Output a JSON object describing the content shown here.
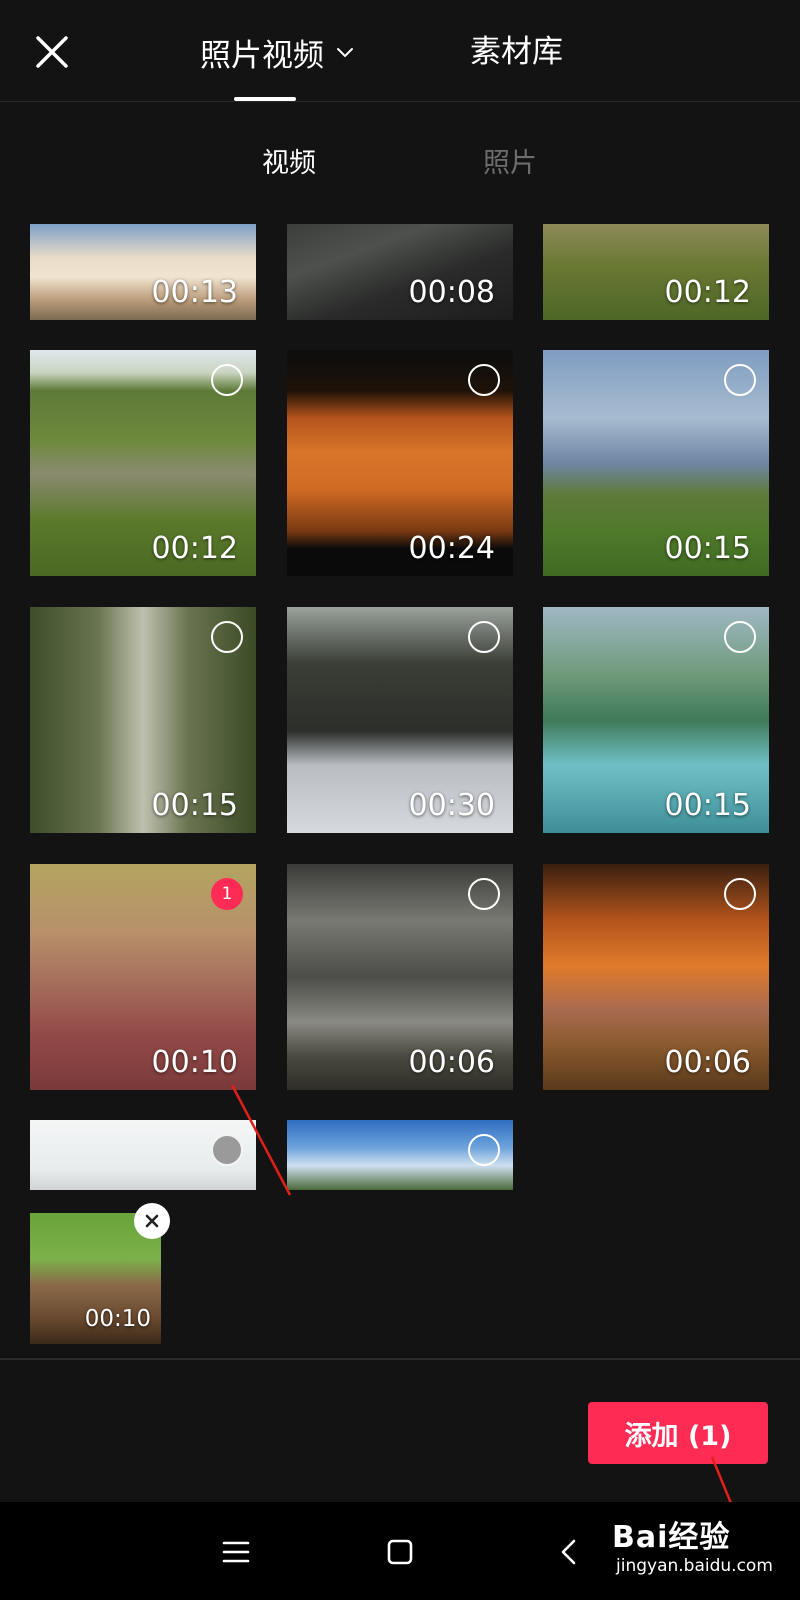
{
  "header": {
    "tab_album": "照片视频",
    "tab_library": "素材库"
  },
  "subtabs": {
    "video": "视频",
    "photo": "照片"
  },
  "grid": {
    "items": [
      {
        "duration": "00:13",
        "selected": null
      },
      {
        "duration": "00:08",
        "selected": null
      },
      {
        "duration": "00:12",
        "selected": null
      },
      {
        "duration": "00:12",
        "selected": null
      },
      {
        "duration": "00:24",
        "selected": null
      },
      {
        "duration": "00:15",
        "selected": null
      },
      {
        "duration": "00:15",
        "selected": null
      },
      {
        "duration": "00:30",
        "selected": null
      },
      {
        "duration": "00:15",
        "selected": null
      },
      {
        "duration": "00:10",
        "selected": "1"
      },
      {
        "duration": "00:06",
        "selected": null
      },
      {
        "duration": "00:06",
        "selected": null
      },
      {
        "duration": "",
        "selected": null
      },
      {
        "duration": "",
        "selected": null
      }
    ]
  },
  "tray": {
    "items": [
      {
        "duration": "00:10"
      }
    ]
  },
  "actions": {
    "add_label": "添加 (1)"
  },
  "watermark": {
    "brand": "Bai经验",
    "url": "jingyan.baidu.com"
  },
  "colors": {
    "accent": "#fe2c55",
    "background": "#131313"
  }
}
